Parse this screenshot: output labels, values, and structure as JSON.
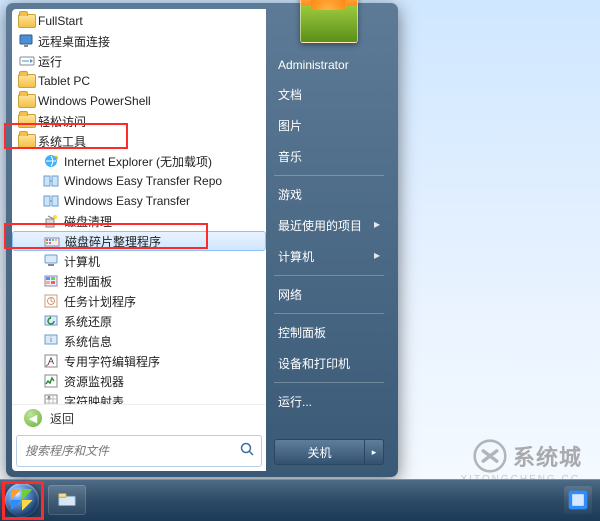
{
  "left": {
    "items": [
      {
        "label": "FullStart",
        "icon": "folder",
        "indent": 0
      },
      {
        "label": "远程桌面连接",
        "icon": "rdp",
        "indent": 0
      },
      {
        "label": "运行",
        "icon": "run",
        "indent": 0
      },
      {
        "label": "Tablet PC",
        "icon": "folder",
        "indent": 0
      },
      {
        "label": "Windows PowerShell",
        "icon": "folder",
        "indent": 0
      },
      {
        "label": "轻松访问",
        "icon": "folder",
        "indent": 0
      },
      {
        "label": "系统工具",
        "icon": "folder",
        "indent": 0,
        "highlight": true
      },
      {
        "label": "Internet Explorer (无加载项)",
        "icon": "ie",
        "indent": 1
      },
      {
        "label": "Windows Easy Transfer Repo",
        "icon": "transfer",
        "indent": 1
      },
      {
        "label": "Windows Easy Transfer",
        "icon": "transfer",
        "indent": 1
      },
      {
        "label": "磁盘清理",
        "icon": "cleanup",
        "indent": 1
      },
      {
        "label": "磁盘碎片整理程序",
        "icon": "defrag",
        "indent": 1,
        "selected": true,
        "highlight": true
      },
      {
        "label": "计算机",
        "icon": "computer",
        "indent": 1
      },
      {
        "label": "控制面板",
        "icon": "cpl",
        "indent": 1
      },
      {
        "label": "任务计划程序",
        "icon": "task",
        "indent": 1
      },
      {
        "label": "系统还原",
        "icon": "restore",
        "indent": 1
      },
      {
        "label": "系统信息",
        "icon": "sysinfo",
        "indent": 1
      },
      {
        "label": "专用字符编辑程序",
        "icon": "char",
        "indent": 1
      },
      {
        "label": "资源监视器",
        "icon": "resmon",
        "indent": 1
      },
      {
        "label": "字符映射表",
        "icon": "charmap",
        "indent": 1
      }
    ],
    "back_label": "返回",
    "search_placeholder": "搜索程序和文件"
  },
  "right": {
    "user": "Administrator",
    "items": [
      {
        "label": "文档"
      },
      {
        "label": "图片"
      },
      {
        "label": "音乐"
      },
      {
        "sep": true
      },
      {
        "label": "游戏"
      },
      {
        "label": "最近使用的项目",
        "arrow": true
      },
      {
        "label": "计算机",
        "arrow": true
      },
      {
        "sep": true
      },
      {
        "label": "网络"
      },
      {
        "sep": true
      },
      {
        "label": "控制面板"
      },
      {
        "label": "设备和打印机"
      },
      {
        "sep": true
      },
      {
        "label": "运行..."
      }
    ],
    "shutdown_label": "关机"
  },
  "watermark": {
    "brand": "系统城",
    "url": "XITONGCHENG.CC"
  }
}
